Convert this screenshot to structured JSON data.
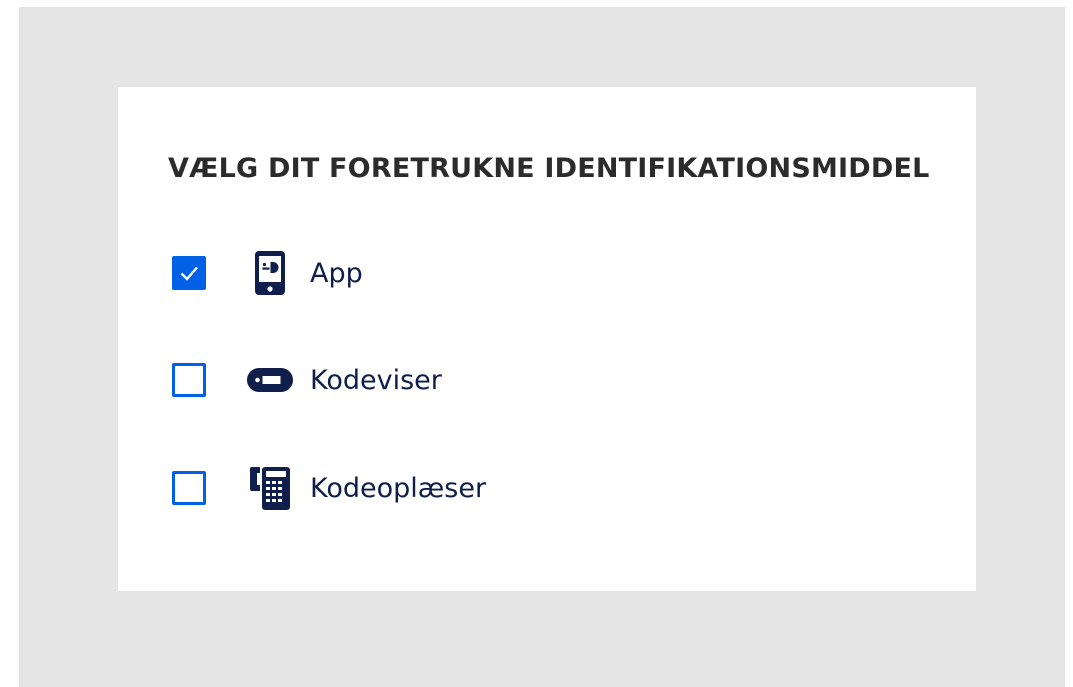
{
  "heading": "VÆLG DIT FORETRUKNE IDENTIFIKATIONSMIDDEL",
  "options": [
    {
      "label": "App",
      "checked": true,
      "icon": "mobile-app-icon"
    },
    {
      "label": "Kodeviser",
      "checked": false,
      "icon": "code-display-icon"
    },
    {
      "label": "Kodeoplæser",
      "checked": false,
      "icon": "code-reader-icon"
    }
  ],
  "colors": {
    "accent": "#0060e6",
    "icon": "#0f1e4a",
    "heading": "#2b2b2b",
    "backdrop": "#e5e5e5"
  }
}
